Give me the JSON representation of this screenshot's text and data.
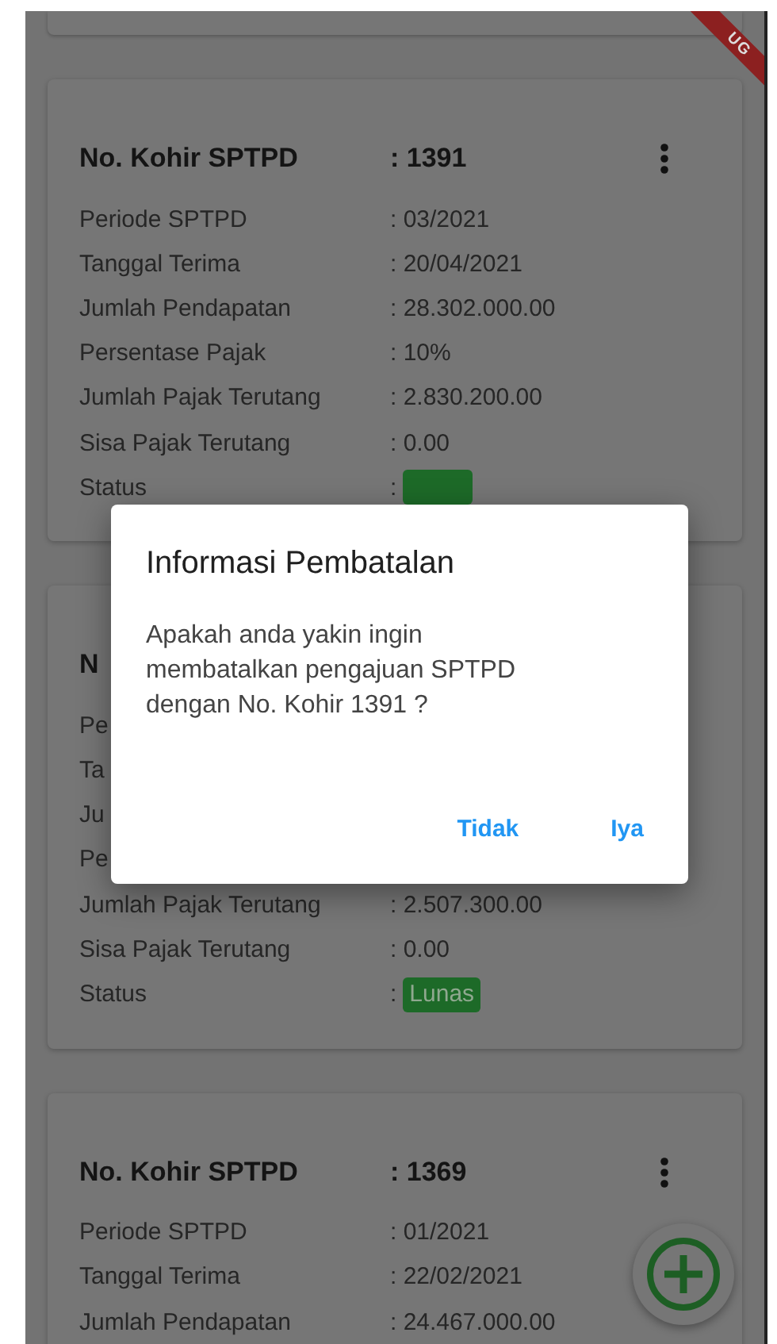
{
  "debug_banner": "UG",
  "cards": [
    {
      "header_label": "No. Kohir SPTPD",
      "header_value": ": 1391",
      "rows": [
        {
          "label": "Periode SPTPD",
          "value": ": 03/2021",
          "kind": "text"
        },
        {
          "label": "Tanggal Terima",
          "value": ": 20/04/2021",
          "kind": "text"
        },
        {
          "label": "Jumlah Pendapatan",
          "value": ": 28.302.000.00",
          "kind": "text"
        },
        {
          "label": "Persentase Pajak",
          "value": ": 10%",
          "kind": "text"
        },
        {
          "label": "Jumlah Pajak Terutang",
          "value": ": 2.830.200.00",
          "kind": "text"
        },
        {
          "label": "Sisa Pajak Terutang",
          "value": ": 0.00",
          "kind": "text"
        },
        {
          "label": "Status",
          "colon": ":",
          "kind": "badge"
        }
      ]
    },
    {
      "header_label": "N",
      "rows": [
        {
          "label": "Pe",
          "kind": "text"
        },
        {
          "label": "Ta",
          "kind": "text"
        },
        {
          "label": "Ju",
          "kind": "text"
        },
        {
          "label": "Pe",
          "kind": "text"
        },
        {
          "label": "Jumlah Pajak Terutang",
          "value": ": 2.507.300.00",
          "kind": "text"
        },
        {
          "label": "Sisa Pajak Terutang",
          "value": ": 0.00",
          "kind": "text"
        },
        {
          "label": "Status",
          "colon": ":",
          "value": "Lunas",
          "kind": "badge"
        }
      ]
    },
    {
      "header_label": "No. Kohir SPTPD",
      "header_value": ": 1369",
      "rows": [
        {
          "label": "Periode SPTPD",
          "value": ": 01/2021",
          "kind": "text"
        },
        {
          "label": "Tanggal Terima",
          "value": ": 22/02/2021",
          "kind": "text"
        },
        {
          "label": "Jumlah Pendapatan",
          "value": ": 24.467.000.00",
          "kind": "text"
        }
      ]
    }
  ],
  "dialog": {
    "title": "Informasi Pembatalan",
    "message": "Apakah anda yakin ingin membatalkan pengajuan SPTPD dengan No. Kohir 1391 ?",
    "buttons": [
      "Tidak",
      "Iya"
    ]
  }
}
